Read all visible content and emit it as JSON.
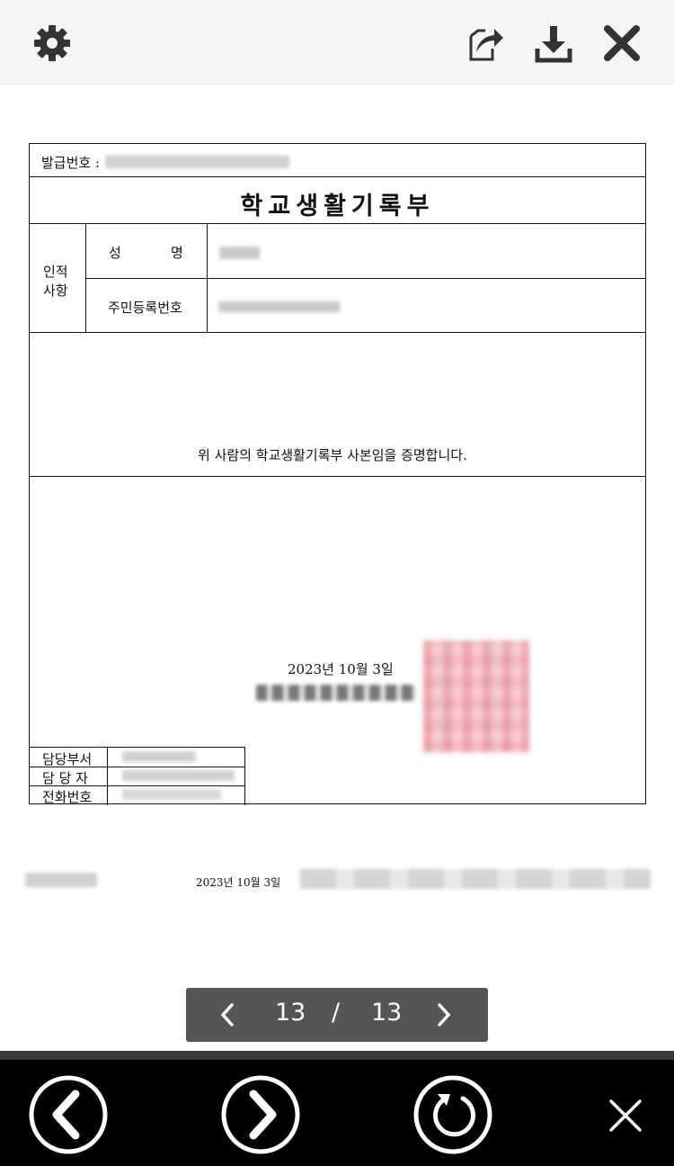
{
  "toolbar": {
    "settings_icon": "gear-icon",
    "share_icon": "share-icon",
    "download_icon": "download-icon",
    "close_icon": "close-icon"
  },
  "document": {
    "issue_no_label": "발급번호 :",
    "title": "학교생활기록부",
    "personal_label_line1": "인적",
    "personal_label_line2": "사항",
    "name_label_1": "성",
    "name_label_2": "명",
    "resident_no_label": "주민등록번호",
    "certify_text": "위 사람의 학교생활기록부 사본임을 증명합니다.",
    "issue_date": "2023년 10월 3일",
    "dept_label": "담당부서",
    "person_label": "담 당 자",
    "phone_label": "전화번호"
  },
  "footer": {
    "date": "2023년 10월 3일"
  },
  "pager": {
    "current": "13",
    "separator": "/",
    "total": "13"
  },
  "bottom_nav": {
    "prev_icon": "chevron-left-circle-icon",
    "next_icon": "chevron-right-circle-icon",
    "refresh_icon": "refresh-icon",
    "close_icon": "close-icon"
  }
}
